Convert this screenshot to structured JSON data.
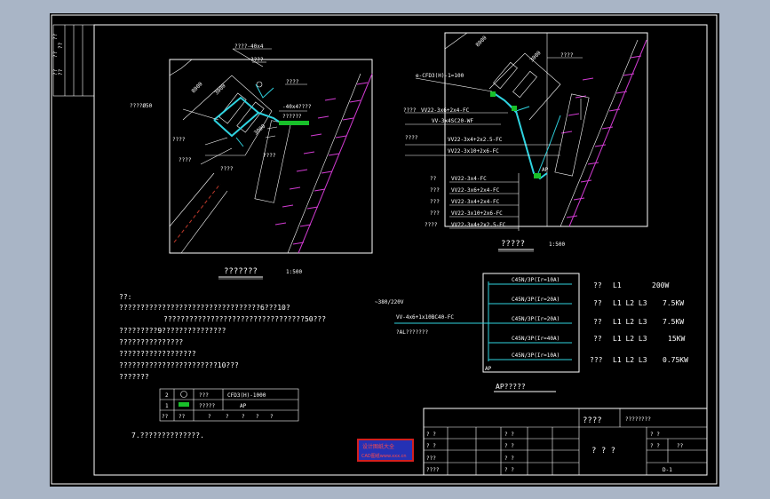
{
  "colors": {
    "background": "#a9b5c6",
    "paper": "#000000",
    "line": "#ffffff",
    "cable": "#2fd3e0",
    "wall": "#d23bd2",
    "accent": "#18c02a",
    "stamp_border": "#d21f1f",
    "stamp_fill": "#2431b5"
  },
  "side_strip": [
    "??",
    "??",
    "??",
    "??",
    "??"
  ],
  "plan_left": {
    "labels": {
      "ground_bar": "????-40x4",
      "ground_bar2": "????",
      "flat_iron": "-40x4????",
      "pipe": "????Ø50",
      "pipe2": "????",
      "cable_tag": "??????",
      "tag_a": "????",
      "tag_b": "????",
      "tag_c": "????",
      "tag_d": "????",
      "dim_a": "8000",
      "dim_b": "3000",
      "dim_c": "3000"
    },
    "title": "???????",
    "scale": "1:500"
  },
  "plan_right": {
    "labels": {
      "conduit": "e-CFD3(H)-1=100",
      "ground_a": "????",
      "cable_b": "VV22-3x6+2x4-FC",
      "cable_c": "VV-3x4SC20-WF",
      "pipe_a": "????",
      "pipe_b": "????",
      "cable_d": "VV22-3x4+2x2.5-FC",
      "cable_e": "VV22-3x10+2x6-FC",
      "ap": "AP",
      "dim_a": "8000",
      "dim_b": "3000"
    },
    "legend_rows": [
      {
        "tag": "??",
        "cable": "VV22-3x4-FC"
      },
      {
        "tag": "???",
        "cable": "VV22-3x6+2x4-FC"
      },
      {
        "tag": "???",
        "cable": "VV22-3x4+2x4-FC"
      },
      {
        "tag": "???",
        "cable": "VV22-3x10+2x6-FC"
      },
      {
        "tag": "????",
        "cable": "VV22-3x4+2x2.5-FC"
      }
    ],
    "title": "?????",
    "scale": "1:500"
  },
  "notes": {
    "heading": "??:",
    "lines": [
      "?????????????????????????????????6???10?",
      "?????????????????????????????????50???",
      "?????????9???????????????",
      "???????????????",
      "??????????????????",
      "???????????????????????10???",
      "???????"
    ]
  },
  "legend_table": {
    "rows": [
      {
        "num": "2",
        "sym": "circle",
        "name": "???",
        "model": "CFD3(H)-1000"
      },
      {
        "num": "1",
        "sym": "box",
        "name": "?????",
        "model": "AP"
      }
    ],
    "header": [
      "??",
      "??",
      "?",
      "?",
      "?",
      "?",
      "?"
    ]
  },
  "footnote": "7.??????????????.",
  "ap_diagram": {
    "supply": "~380/220V",
    "incoming_cable": "VV-4x6+1x10BC40-FC",
    "incoming_label": "?AL???????",
    "breakers": [
      "C45N/3P(Ir=10A)",
      "C45N/3P(Ir=20A)",
      "C45N/3P(Ir=20A)",
      "C45N/3P(Ir=40A)",
      "C45N/3P(Ir=10A)"
    ],
    "panel_label": "AP",
    "title": "AP?????",
    "loads": [
      {
        "name": "??",
        "phases": "L1",
        "power": "200W"
      },
      {
        "name": "??",
        "phases": "L1  L2  L3",
        "power": "7.5KW"
      },
      {
        "name": "??",
        "phases": "L1  L2  L3",
        "power": "7.5KW"
      },
      {
        "name": "??",
        "phases": "L1  L2  L3",
        "power": "15KW"
      },
      {
        "name": "???",
        "phases": "L1  L2  L3",
        "power": "0.75KW"
      }
    ]
  },
  "stamp": {
    "line1": "设计图纸大全",
    "line2": "CAD图纸www.xxx.cn"
  },
  "title_block": {
    "project": "????",
    "subtitle": "????????",
    "drawing_name": "? ? ?",
    "left_rows": [
      "? ?",
      "? ?",
      "???",
      "????"
    ],
    "mid_rows": [
      "? ?",
      "? ?",
      "? ?",
      "? ?"
    ],
    "right_rows": [
      "? ?",
      "? ?"
    ],
    "right_value": "??",
    "drawing_no": "D-1"
  }
}
